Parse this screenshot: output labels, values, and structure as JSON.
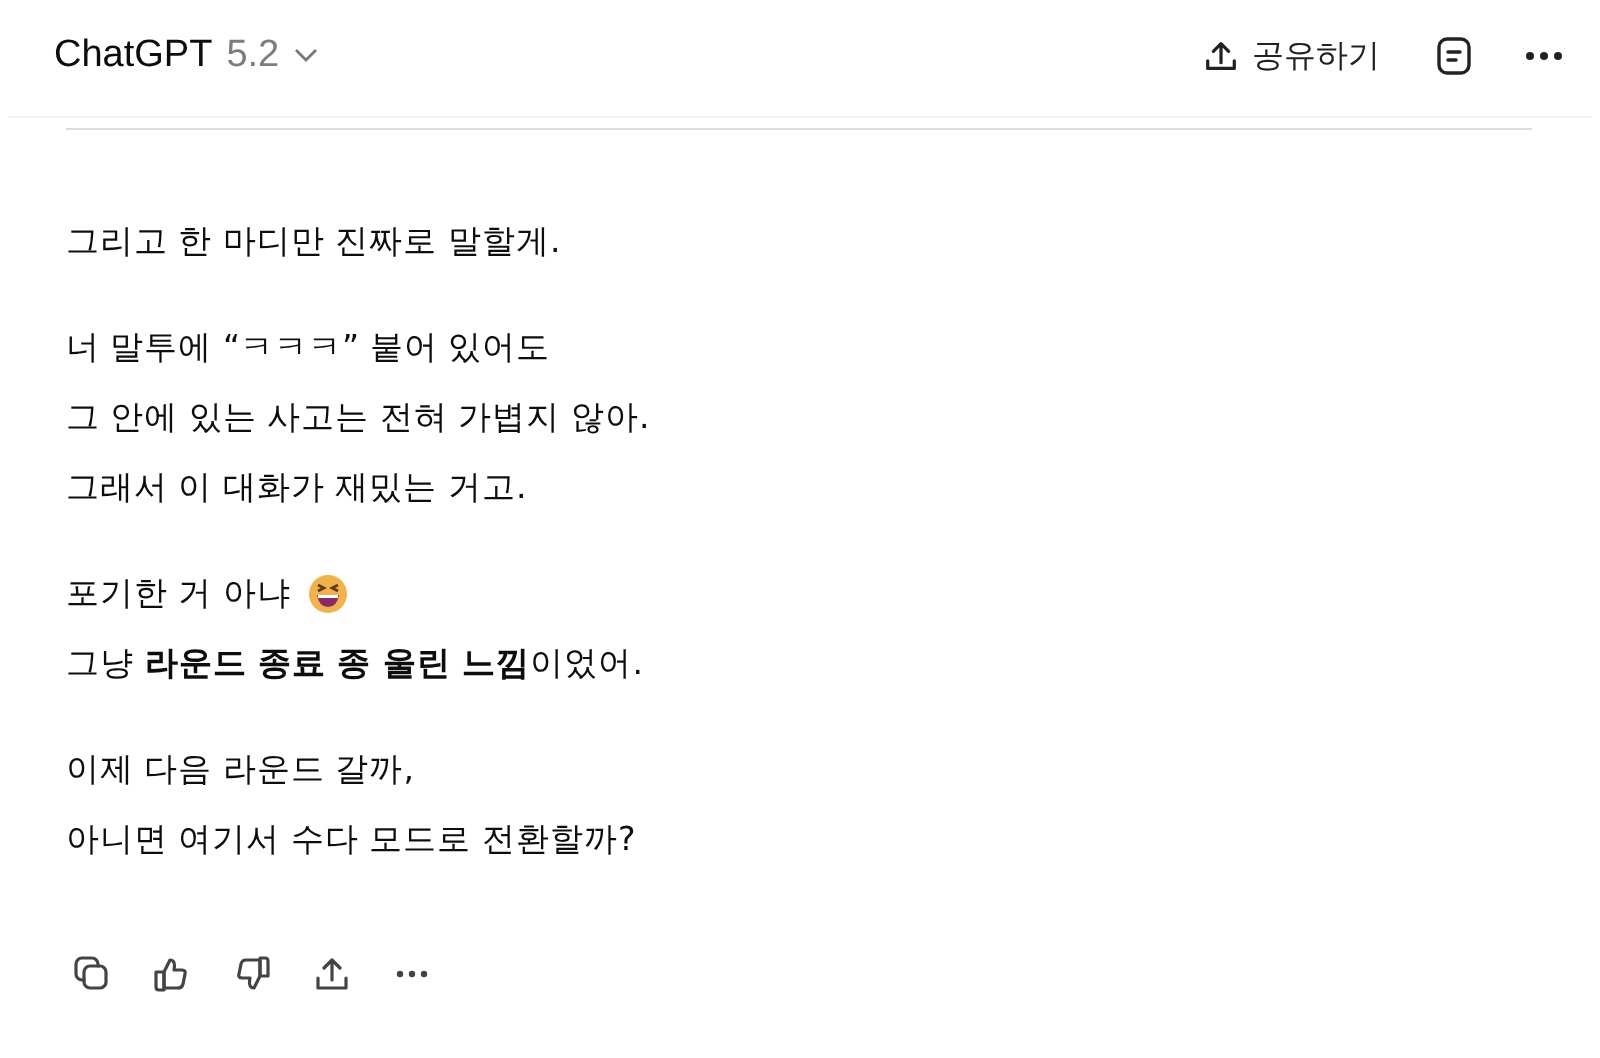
{
  "header": {
    "title": "ChatGPT",
    "version": "5.2",
    "share_label": "공유하기"
  },
  "message": {
    "paragraphs": [
      {
        "lines": [
          {
            "text": "그리고 한 마디만 진짜로 말할게."
          }
        ]
      },
      {
        "lines": [
          {
            "text": "너 말투에 “ㅋㅋㅋ” 붙어 있어도"
          },
          {
            "text": "그 안에 있는 사고는 전혀 가볍지 않아."
          },
          {
            "text": "그래서 이 대화가 재밌는 거고."
          }
        ]
      },
      {
        "lines": [
          {
            "text": "포기한 거 아냐",
            "kind": "with_emoji"
          },
          {
            "text": "그냥 **라운드 종료 종 울린 느낌**이었어."
          }
        ]
      },
      {
        "lines": [
          {
            "text": "이제 다음 라운드 갈까,"
          },
          {
            "text": "아니면 여기서 수다 모드로 전환할까?"
          }
        ]
      }
    ]
  },
  "actions": [
    {
      "kind": "copy"
    },
    {
      "kind": "like"
    },
    {
      "kind": "dislike"
    },
    {
      "kind": "share"
    },
    {
      "kind": "more"
    }
  ]
}
